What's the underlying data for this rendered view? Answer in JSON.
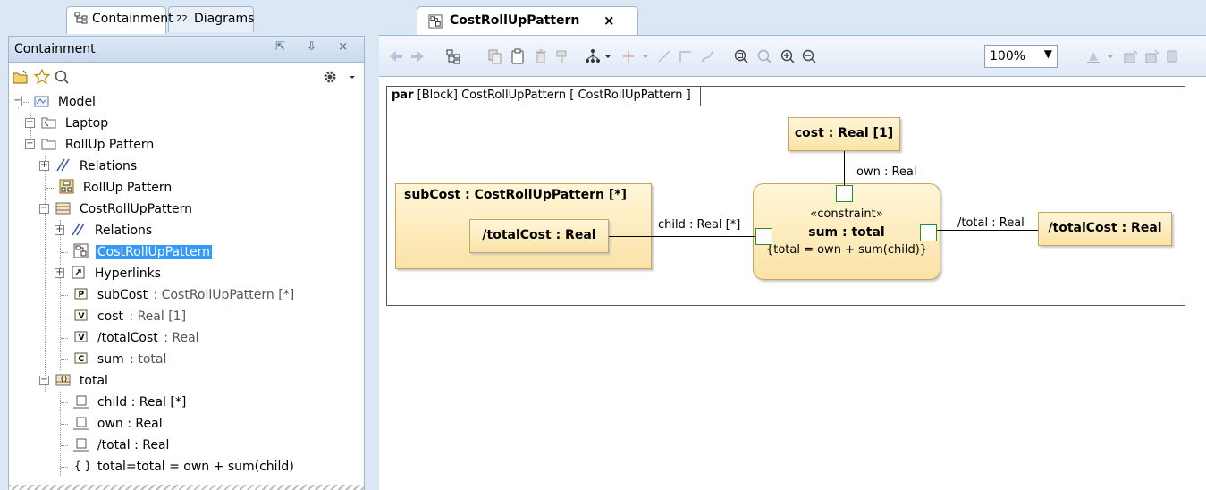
{
  "left_tabs": [
    {
      "label": "Containment",
      "active": true
    },
    {
      "label": "Diagrams",
      "active": false
    }
  ],
  "panel": {
    "title": "Containment",
    "controls": "⇱ ⇩ ×"
  },
  "tree": [
    {
      "label": "Model",
      "icon": "model-icon"
    },
    {
      "label": "Laptop",
      "icon": "package-icon"
    },
    {
      "label": "RollUp Pattern",
      "icon": "package-icon"
    },
    {
      "label": "Relations",
      "icon": "relations-icon"
    },
    {
      "label": "RollUp Pattern",
      "icon": "diagram-icon"
    },
    {
      "label": "CostRollUpPattern",
      "icon": "block-icon"
    },
    {
      "label": "Relations",
      "icon": "relations-icon"
    },
    {
      "label": "CostRollUpPattern",
      "icon": "parametric-diagram-icon",
      "selected": true
    },
    {
      "label": "Hyperlinks",
      "icon": "hyperlink-icon"
    },
    {
      "label": "subCost",
      "type": " : CostRollUpPattern [*]",
      "icon": "part-property-icon"
    },
    {
      "label": "cost",
      "type": " : Real [1]",
      "icon": "value-property-icon"
    },
    {
      "label": "/totalCost",
      "type": " : Real",
      "icon": "value-property-icon"
    },
    {
      "label": "sum",
      "type": " : total",
      "icon": "constraint-property-icon"
    },
    {
      "label": "total",
      "icon": "constraint-block-icon"
    },
    {
      "label": "child : Real [*]",
      "icon": "parameter-icon"
    },
    {
      "label": "own : Real",
      "icon": "parameter-icon"
    },
    {
      "label": "/total : Real",
      "icon": "parameter-icon"
    },
    {
      "label": "total=total = own + sum(child)",
      "icon": "constraint-icon"
    }
  ],
  "editor": {
    "tab_label": "CostRollUpPattern",
    "close": "×",
    "zoom": "100%",
    "zoom_arrow": "▼"
  },
  "diagram": {
    "frame_kind": "par",
    "frame_rest": " [Block] CostRollUpPattern [ CostRollUpPattern ]",
    "cost_node": "cost : Real [1]",
    "subcost_node": "subCost : CostRollUpPattern [*]",
    "totalcost_inner": "/totalCost : Real",
    "constraint_stereotype": "«constraint»",
    "constraint_name": "sum : total",
    "constraint_expr": "{total = own + sum(child)}",
    "totalcost_node": "/totalCost : Real",
    "label_own": "own : Real",
    "label_child": "child : Real [*]",
    "label_total": "/total : Real"
  }
}
